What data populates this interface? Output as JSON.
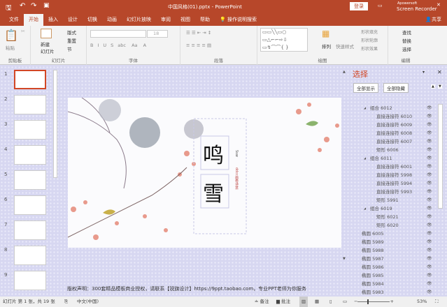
{
  "titlebar": {
    "title": "中国风格(01).pptx - PowerPoint",
    "login": "登录",
    "recorder_brand": "Apowersoft",
    "recorder": "Screen Recorder",
    "share": "共享"
  },
  "tabs": [
    "文件",
    "开始",
    "插入",
    "设计",
    "切换",
    "动画",
    "幻灯片放映",
    "审阅",
    "视图",
    "帮助",
    "操作说明搜索"
  ],
  "ribbon": {
    "clipboard": {
      "paste": "粘贴",
      "label": "剪贴板"
    },
    "slides": {
      "new_slide": "新建\n幻灯片",
      "layout": "版式",
      "reset": "重置",
      "section": "节",
      "label": "幻灯片"
    },
    "font": {
      "size": "18",
      "label": "字体",
      "bold": "B",
      "italic": "I",
      "underline": "U",
      "strike": "S",
      "abc": "abc",
      "aa": "Aa",
      "a": "A"
    },
    "paragraph": {
      "label": "段落"
    },
    "drawing": {
      "arrange": "排列",
      "quick_styles": "快速样式",
      "fill": "形状填充",
      "outline": "形状轮廓",
      "effects": "形状效果",
      "label": "绘图"
    },
    "editing": {
      "find": "查找",
      "replace": "替换",
      "select": "选择",
      "label": "编辑"
    }
  },
  "thumbnails": [
    "1",
    "2",
    "3",
    "4",
    "5",
    "6",
    "7",
    "8",
    "9"
  ],
  "slide": {
    "char1": "鸣",
    "char2": "雪",
    "side_text_1": "Ssw",
    "side_text_2": "ddcc画卷诗意"
  },
  "notes": {
    "text": "版权声明：300套精品模板商业授权，请联系【锐旗设计】https://9ppt.taobao.com，专业PPT老师为你服务"
  },
  "selection_pane": {
    "title": "选择",
    "show_all": "全部显示",
    "hide_all": "全部隐藏",
    "items": [
      {
        "label": "组合 6012",
        "level": 0,
        "group": true
      },
      {
        "label": "直接连接符 6010",
        "level": 1
      },
      {
        "label": "直接连接符 6009",
        "level": 1
      },
      {
        "label": "直接连接符 6008",
        "level": 1
      },
      {
        "label": "直接连接符 6007",
        "level": 1
      },
      {
        "label": "矩形 6006",
        "level": 1
      },
      {
        "label": "组合 6011",
        "level": 0,
        "group": true
      },
      {
        "label": "直接连接符 6001",
        "level": 1
      },
      {
        "label": "直接连接符 5998",
        "level": 1
      },
      {
        "label": "直接连接符 5994",
        "level": 1
      },
      {
        "label": "直接连接符 5993",
        "level": 1
      },
      {
        "label": "矩形 5991",
        "level": 1
      },
      {
        "label": "组合 6019",
        "level": 0,
        "group": true
      },
      {
        "label": "矩形 6021",
        "level": 1
      },
      {
        "label": "矩形 6020",
        "level": 1
      },
      {
        "label": "椭圆 6005",
        "level": -1
      },
      {
        "label": "椭圆 5989",
        "level": -1
      },
      {
        "label": "椭圆 5988",
        "level": -1
      },
      {
        "label": "椭圆 5987",
        "level": -1
      },
      {
        "label": "椭圆 5986",
        "level": -1
      },
      {
        "label": "椭圆 5985",
        "level": -1
      },
      {
        "label": "椭圆 5984",
        "level": -1
      },
      {
        "label": "椭圆 5983",
        "level": -1
      }
    ]
  },
  "status": {
    "slide_info": "幻灯片 第 1 张，共 19 张",
    "language": "中文(中国)",
    "notes": "备注",
    "comments": "批注",
    "zoom": "53%"
  },
  "colors": {
    "accent": "#b7472a",
    "pane_bg": "#d7d7f1"
  }
}
